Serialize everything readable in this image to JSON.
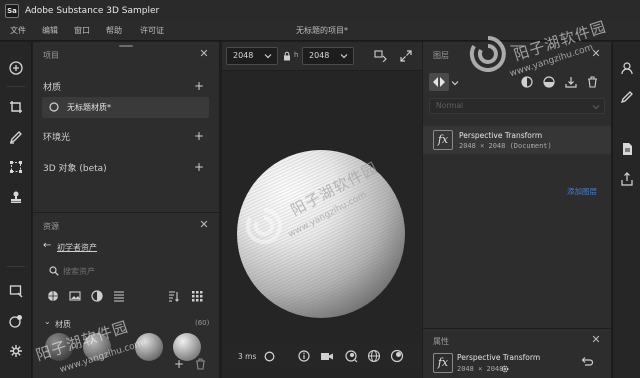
{
  "app": {
    "logo_text": "Sa",
    "title": "Adobe Substance 3D Sampler"
  },
  "menu": {
    "items": [
      "文件",
      "编辑",
      "窗口",
      "帮助",
      "许可证"
    ],
    "document_title": "无标题的项目*"
  },
  "project_panel": {
    "title": "项目",
    "materials_label": "材质",
    "material_item": "无标题材质*",
    "lights_label": "环境光",
    "objects_label": "3D 对象 (beta)"
  },
  "assets_panel": {
    "title": "资源",
    "breadcrumb": "初学者资产",
    "search_placeholder": "搜索资产",
    "category_label": "材质",
    "category_count": "(60)"
  },
  "viewport": {
    "resolution_width": "2048",
    "resolution_height": "2048",
    "render_time": "3 ms"
  },
  "layers_panel": {
    "title": "图层",
    "blend_mode": "Normal",
    "layers": [
      {
        "name": "Perspective Transform",
        "size": "2048 × 2048 (Document)"
      }
    ],
    "add_layer_link": "添加图层"
  },
  "properties_panel": {
    "title": "属性",
    "layer_name": "Perspective Transform",
    "layer_size": "2048 × 2048"
  },
  "watermark": {
    "text": "阳子湖软件园",
    "url": "www.yangzihu.com"
  },
  "colors": {
    "accent": "#3a86ff",
    "panel": "#2d2d2d",
    "background": "#1e1e1e"
  }
}
